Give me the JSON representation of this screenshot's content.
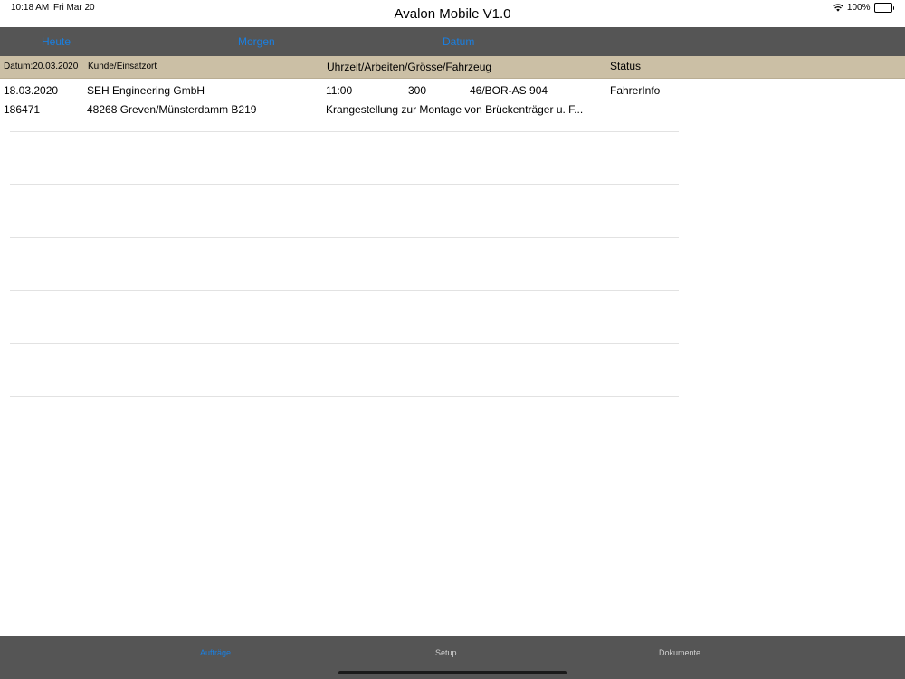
{
  "status_bar": {
    "time": "10:18 AM",
    "date": "Fri Mar 20",
    "battery": "100%",
    "wifi_icon": "wifi-icon",
    "battery_icon": "battery-icon"
  },
  "app": {
    "title": "Avalon Mobile V1.0"
  },
  "nav": {
    "heute": "Heute",
    "morgen": "Morgen",
    "datum": "Datum"
  },
  "table": {
    "headers": {
      "datum": "Datum:20.03.2020",
      "kunde": "Kunde/Einsatzort",
      "uhrzeit": "Uhrzeit/Arbeiten/Grösse/Fahrzeug",
      "status": "Status"
    },
    "rows": [
      {
        "date": "18.03.2020",
        "customer": "SEH Engineering GmbH",
        "time": "11:00",
        "work": "300",
        "vehicle": "46/BOR-AS 904",
        "status": "FahrerInfo",
        "order": "186471",
        "location": "48268 Greven/Münsterdamm B219",
        "description": "Krangestellung zur Montage von Brückenträger u. F..."
      }
    ]
  },
  "tabs": {
    "auftraege": "Aufträge",
    "setup": "Setup",
    "dokumente": "Dokumente"
  },
  "colors": {
    "accent": "#1a7fe0",
    "bar_background": "#555555",
    "header_background": "#cbbfa5"
  }
}
